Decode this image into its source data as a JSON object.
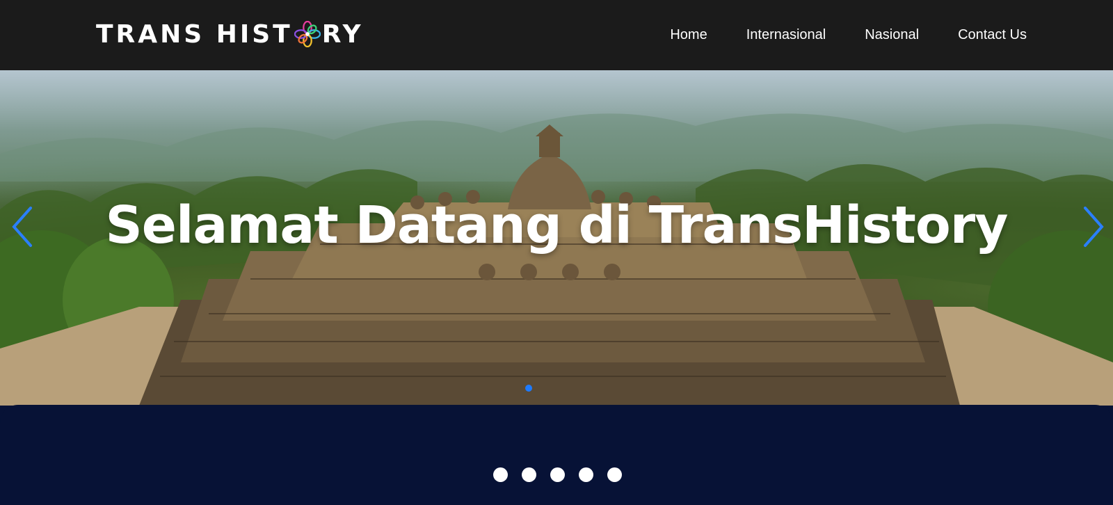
{
  "brand": {
    "logo_text_before": "TRANS HIST",
    "logo_text_after": "RY",
    "logo_icon": "flower-logo-icon"
  },
  "nav": {
    "items": [
      {
        "label": "Home"
      },
      {
        "label": "Internasional"
      },
      {
        "label": "Nasional"
      },
      {
        "label": "Contact Us"
      }
    ]
  },
  "hero": {
    "title": "Selamat Datang di TransHistory",
    "prev_icon": "chevron-left-icon",
    "next_icon": "chevron-right-icon",
    "active_indicator_color": "#1e7bff"
  },
  "pagination": {
    "count": 5,
    "dot_color": "#ffffff"
  },
  "colors": {
    "navbar": "#1b1b1b",
    "panel": "#071236",
    "text": "#ffffff"
  }
}
